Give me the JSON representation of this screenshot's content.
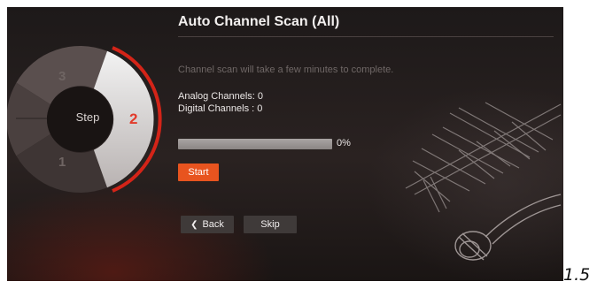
{
  "wizard": {
    "center_label": "Step",
    "steps": [
      {
        "number": "1",
        "active": false
      },
      {
        "number": "2",
        "active": true
      },
      {
        "number": "3",
        "active": false
      }
    ],
    "current_step": 2
  },
  "header": {
    "title": "Auto Channel Scan (All)"
  },
  "main": {
    "subtitle": "Channel scan will take a few minutes to complete.",
    "analog_line": "Analog Channels:  0",
    "digital_line": "Digital Channels : 0",
    "progress_percent": 0,
    "progress_label": "0%",
    "start_label": "Start"
  },
  "footer": {
    "back_label": "Back",
    "skip_label": "Skip"
  },
  "caption": "1.5",
  "colors": {
    "accent": "#e8541f",
    "active_step": "#e23a2a",
    "background": "#221c1b"
  },
  "icons": {
    "back": "chevron-left-icon",
    "illustration": "antenna-illustration"
  }
}
